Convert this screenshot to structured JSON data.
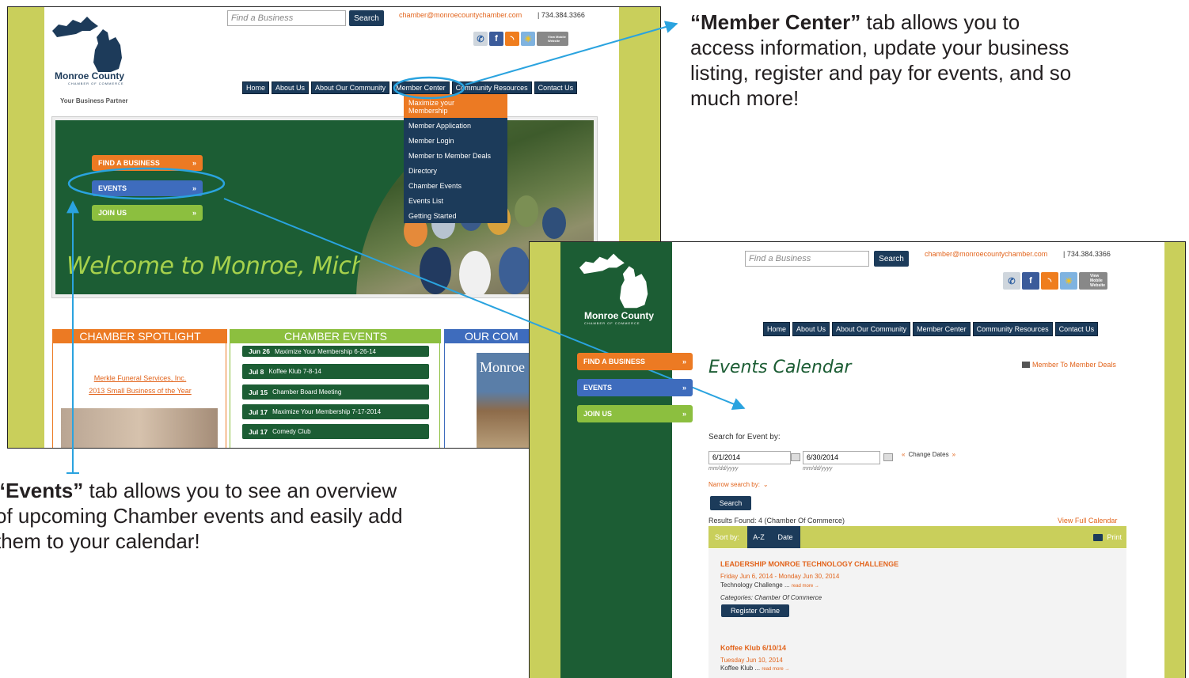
{
  "callouts": {
    "member_center": {
      "bold": "“Member Center”",
      "lines": [
        "tab allows you to",
        "access information, update your business",
        "listing, register and pay for events, and so",
        "much more!"
      ]
    },
    "events": {
      "bold": "“Events”",
      "lines": [
        "tab allows you to see an overview",
        "of upcoming Chamber events and easily add",
        "them to your calendar!"
      ]
    }
  },
  "site": {
    "logo_name": "Monroe County",
    "logo_sub": "CHAMBER OF COMMERCE",
    "tagline": "Your Business Partner",
    "search_placeholder": "Find a Business",
    "search_button": "Search",
    "email": "chamber@monroecountychamber.com",
    "phone": "|  734.384.3366",
    "social_icons": [
      "mobile-app-icon",
      "facebook-icon",
      "rss-icon",
      "weather-icon",
      "mobile-website-icon"
    ],
    "mobile_label": "View Mobile Website",
    "nav": [
      "Home",
      "About Us",
      "About Our Community",
      "Member Center",
      "Community Resources",
      "Contact Us"
    ],
    "side_buttons": [
      "FIND A BUSINESS",
      "EVENTS",
      "JOIN US"
    ],
    "side_button_arrow": "»",
    "colors": {
      "orange": "#ec7a23",
      "blue": "#3e6cbd",
      "green": "#8cbf3f",
      "navy": "#1c3b5a",
      "forest": "#1c5d34"
    }
  },
  "shot1": {
    "dropdown": [
      "Maximize your",
      "Membership",
      "Member Application",
      "Member Login",
      "Member to Member Deals",
      "Directory",
      "Chamber Events",
      "Events List",
      "Getting Started"
    ],
    "welcome": "Welcome to Monroe, Michigan!",
    "columns": {
      "spotlight": "CHAMBER SPOTLIGHT",
      "events": "CHAMBER EVENTS",
      "community": "OUR COM"
    },
    "spotlight_links": [
      "Merkle Funeral Services, Inc.",
      "2013 Small Business of the Year"
    ],
    "community_cover": "Monroe",
    "events_list": [
      {
        "date": "Jun 26",
        "title": "Maximize Your Membership 6-26-14"
      },
      {
        "date": "Jul 8",
        "title": "Koffee Klub 7-8-14"
      },
      {
        "date": "Jul 15",
        "title": "Chamber Board Meeting"
      },
      {
        "date": "Jul 17",
        "title": "Maximize Your Membership 7-17-2014"
      },
      {
        "date": "Jul 17",
        "title": "Comedy Club"
      }
    ]
  },
  "shot2": {
    "page_title": "Events Calendar",
    "deals_link": "Member To Member Deals",
    "search_for": "Search for Event by:",
    "start_date": "6/1/2014",
    "end_date": "6/30/2014",
    "date_format": "mm/dd/yyyy",
    "change_dates": "Change Dates",
    "narrow": "Narrow search by:",
    "search_button": "Search",
    "results": "Results Found: 4 (Chamber Of Commerce)",
    "view_full": "View Full Calendar",
    "sort_label": "Sort by:",
    "sort_az": "A-Z",
    "sort_date": "Date",
    "print": "Print",
    "events": [
      {
        "title": "LEADERSHIP MONROE TECHNOLOGY CHALLENGE",
        "dates": "Friday Jun 6, 2014 - Monday Jun 30, 2014",
        "desc": "Technology Challenge ...",
        "more": "read more →",
        "categories": "Categories: Chamber Of Commerce",
        "register": "Register Online"
      },
      {
        "title": "Koffee Klub 6/10/14",
        "dates": "Tuesday Jun 10, 2014",
        "desc": "Koffee Klub ...",
        "more": "read more →"
      }
    ]
  }
}
